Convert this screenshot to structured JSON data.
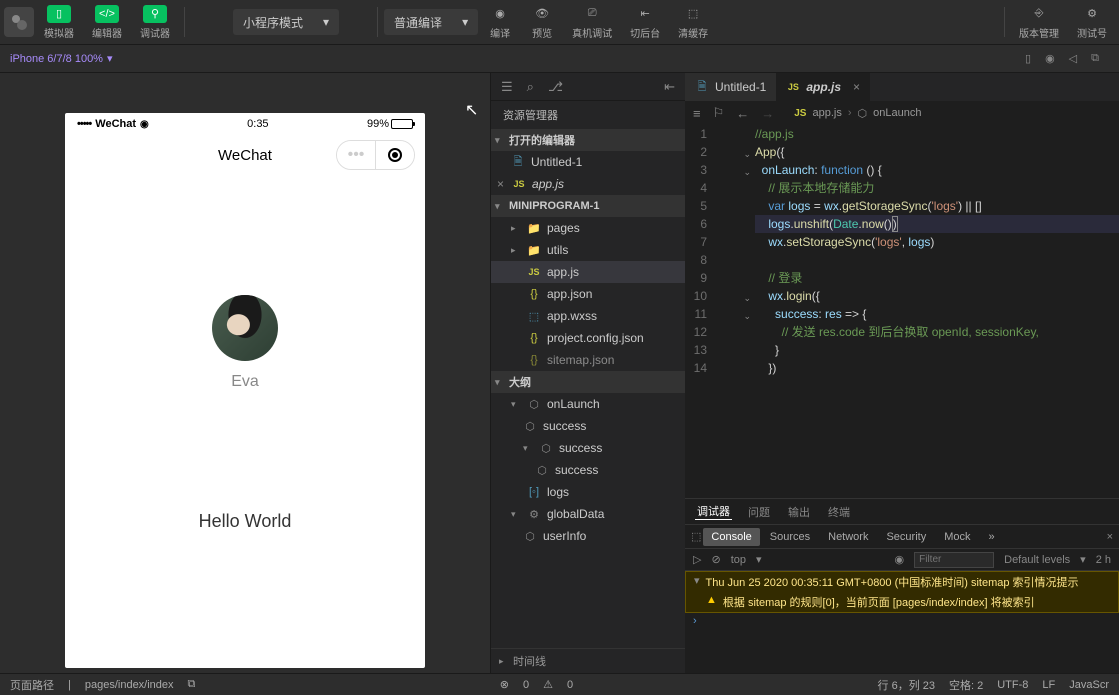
{
  "toolbar": {
    "simulator": "模拟器",
    "editor": "编辑器",
    "debugger": "调试器",
    "mode_dropdown": "小程序模式",
    "compile_dropdown": "普通编译",
    "compile": "编译",
    "preview": "预览",
    "real_debug": "真机调试",
    "background": "切后台",
    "clear_cache": "清缓存",
    "version_mgmt": "版本管理",
    "test_account": "测试号"
  },
  "device_bar": {
    "device": "iPhone 6/7/8 100%"
  },
  "simulator": {
    "status_time": "0:35",
    "battery_pct": "99%",
    "carrier": "WeChat",
    "nav_title": "WeChat",
    "user_name": "Eva",
    "hello_text": "Hello World"
  },
  "explorer": {
    "title": "资源管理器",
    "open_editors": "打开的编辑器",
    "project_name": "MINIPROGRAM-1",
    "outline_title": "大纲",
    "timeline_title": "时间线",
    "files": {
      "untitled": "Untitled-1",
      "appjs": "app.js",
      "pages": "pages",
      "utils": "utils",
      "appjson": "app.json",
      "appwxss": "app.wxss",
      "projectconfig": "project.config.json",
      "sitemap": "sitemap.json"
    },
    "outline": {
      "onLaunch": "onLaunch",
      "success": "success",
      "logs": "logs",
      "globalData": "globalData",
      "userInfo": "userInfo"
    }
  },
  "editor": {
    "tab1": "Untitled-1",
    "tab2": "app.js",
    "breadcrumb_file": "app.js",
    "breadcrumb_symbol": "onLaunch",
    "lines": [
      "1",
      "2",
      "3",
      "4",
      "5",
      "6",
      "7",
      "8",
      "9",
      "10",
      "11",
      "12",
      "13",
      "14"
    ]
  },
  "code": {
    "l1": "//app.js",
    "l2_app": "App",
    "l3_key": "onLaunch",
    "l3_fn": "function",
    "l4_comment": "// 展示本地存储能力",
    "l5_var": "var",
    "l5_logs": "logs",
    "l5_wx": "wx",
    "l5_get": "getStorageSync",
    "l5_str": "'logs'",
    "l6_logs": "logs",
    "l6_unshift": "unshift",
    "l6_date": "Date",
    "l6_now": "now",
    "l7_wx": "wx",
    "l7_set": "setStorageSync",
    "l7_str": "'logs'",
    "l7_logs2": "logs",
    "l9_comment": "// 登录",
    "l10_wx": "wx",
    "l10_login": "login",
    "l11_success": "success",
    "l11_res": "res",
    "l12_comment": "// 发送 res.code 到后台换取 openId, sessionKey,"
  },
  "bottom_panel": {
    "tabs": {
      "debugger": "调试器",
      "problems": "问题",
      "output": "输出",
      "terminal": "终端"
    },
    "devtabs": {
      "console": "Console",
      "sources": "Sources",
      "network": "Network",
      "security": "Security",
      "mock": "Mock"
    },
    "context": "top",
    "filter_placeholder": "Filter",
    "levels": "Default levels",
    "hidden": "2 h",
    "msg1": "Thu Jun 25 2020 00:35:11 GMT+0800 (中国标准时间) sitemap 索引情况提示",
    "msg2": "根据 sitemap 的规则[0]，当前页面 [pages/index/index] 将被索引"
  },
  "status_bar": {
    "path_label": "页面路径",
    "path": "pages/index/index",
    "errors": "0",
    "warnings": "0",
    "cursor": "行 6，列 23",
    "spaces": "空格: 2",
    "encoding": "UTF-8",
    "eol": "LF",
    "lang": "JavaScr"
  }
}
